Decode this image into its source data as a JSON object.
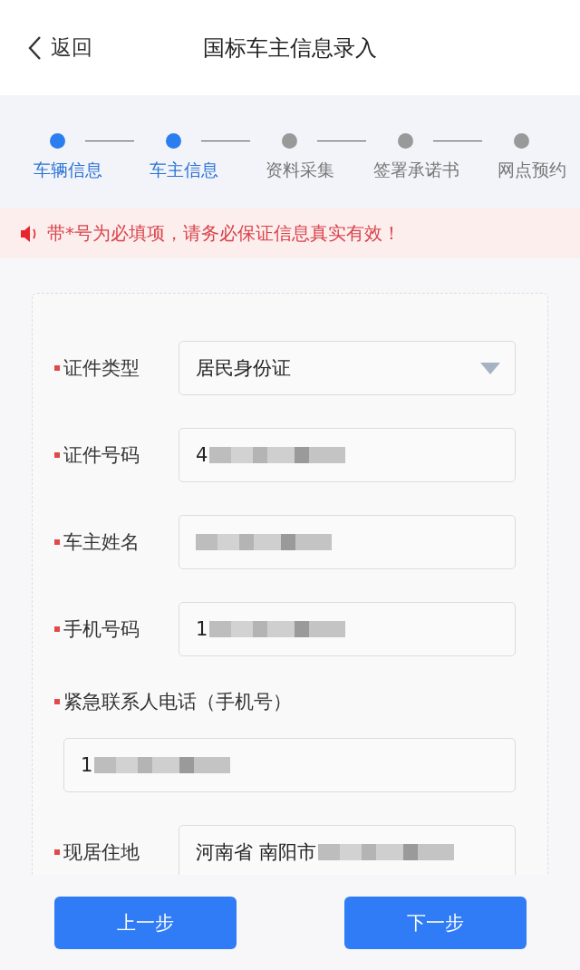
{
  "header": {
    "back_label": "返回",
    "title": "国标车主信息录入"
  },
  "steps": [
    {
      "label": "车辆信息",
      "active": true
    },
    {
      "label": "车主信息",
      "active": true
    },
    {
      "label": "资料采集",
      "active": false
    },
    {
      "label": "签署承诺书",
      "active": false
    },
    {
      "label": "网点预约",
      "active": false
    }
  ],
  "notice": {
    "text": "带*号为必填项，请务必保证信息真实有效！"
  },
  "form": [
    {
      "kind": "select",
      "label": "证件类型",
      "required": true,
      "value": "居民身份证"
    },
    {
      "kind": "inline",
      "label": "证件号码",
      "required": true,
      "value": "4",
      "redacted": true
    },
    {
      "kind": "inline",
      "label": "车主姓名",
      "required": true,
      "redacted": true
    },
    {
      "kind": "inline",
      "label": "手机号码",
      "required": true,
      "value": "1",
      "redacted": true
    },
    {
      "kind": "stacked",
      "label": "紧急联系人电话（手机号）",
      "required": true,
      "value": "1",
      "redacted": true
    },
    {
      "kind": "inline",
      "label": "现居住地",
      "required": true,
      "value": "河南省 南阳市",
      "redacted": true
    }
  ],
  "buttons": [
    {
      "label": "上一步"
    },
    {
      "label": "下一步"
    }
  ]
}
